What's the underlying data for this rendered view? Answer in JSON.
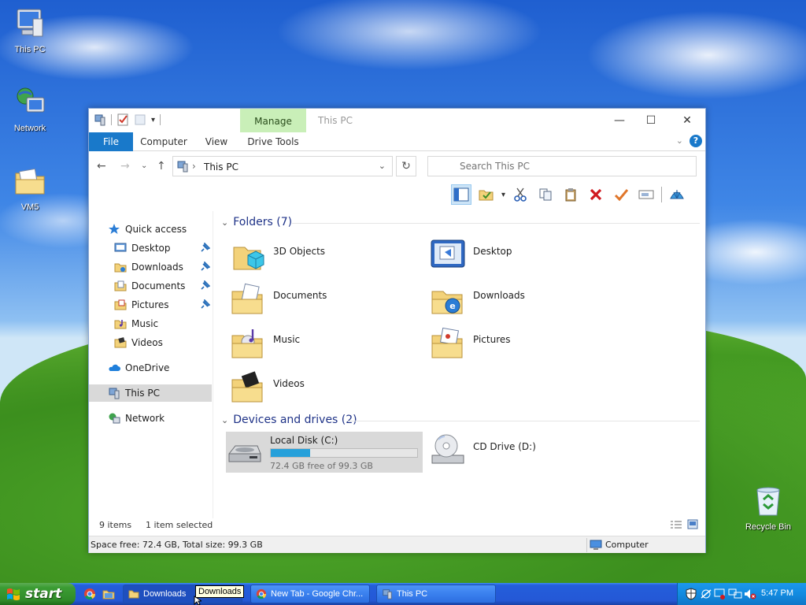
{
  "desktop": {
    "icons": [
      {
        "label": "This PC"
      },
      {
        "label": "Network"
      },
      {
        "label": "VM5"
      },
      {
        "label": "Recycle Bin"
      }
    ]
  },
  "window": {
    "title": "This PC",
    "manage_tab": "Manage",
    "tabs": {
      "file": "File",
      "computer": "Computer",
      "view": "View",
      "drive_tools": "Drive Tools"
    },
    "address": {
      "crumb": "This PC"
    },
    "search": {
      "placeholder": "Search This PC"
    },
    "nav": {
      "quick_access": "Quick access",
      "items": [
        "Desktop",
        "Downloads",
        "Documents",
        "Pictures",
        "Music",
        "Videos"
      ],
      "onedrive": "OneDrive",
      "this_pc": "This PC",
      "network": "Network"
    },
    "folders": {
      "header": "Folders (7)",
      "items": [
        "3D Objects",
        "Desktop",
        "Documents",
        "Downloads",
        "Music",
        "Pictures",
        "Videos"
      ]
    },
    "drives": {
      "header": "Devices and drives (2)",
      "c": {
        "name": "Local Disk (C:)",
        "free": "72.4 GB free of 99.3 GB",
        "used_fraction": 0.271
      },
      "d": {
        "name": "CD Drive (D:)"
      }
    },
    "status": {
      "items": "9 items",
      "selected": "1 item selected"
    },
    "details": {
      "space": "Space free: 72.4 GB, Total size: 99.3 GB",
      "location": "Computer"
    }
  },
  "taskbar": {
    "start": "start",
    "tasks": [
      {
        "label": "Downloads"
      },
      {
        "label": "New Tab - Google Chr..."
      },
      {
        "label": "This PC"
      }
    ],
    "tooltip": "Downloads",
    "clock": "5:47 PM"
  }
}
